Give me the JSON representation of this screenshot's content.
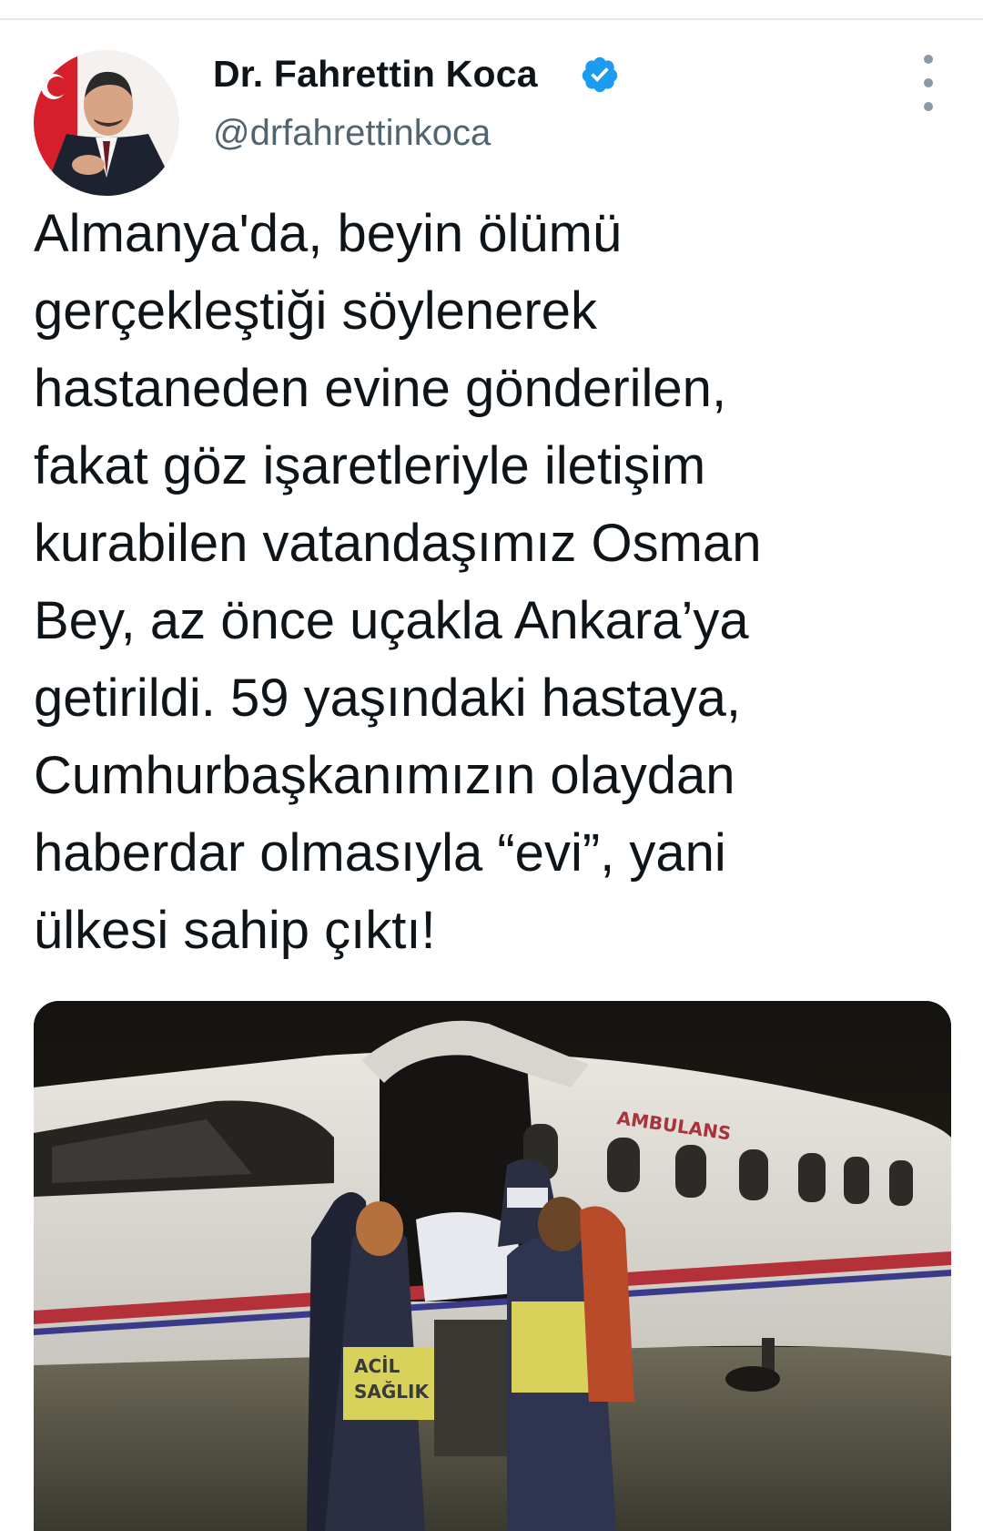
{
  "author": {
    "display_name": "Dr. Fahrettin Koca",
    "handle": "@drfahrettinkoca",
    "verified": true,
    "verified_badge_color": "#1d9bf0"
  },
  "tweet": {
    "lines": [
      "Almanya'da, beyin ölümü",
      "gerçekleştiği söylenerek",
      "hastaneden evine gönderilen,",
      "fakat göz işaretleriyle iletişim",
      "kurabilen vatandaşımız Osman",
      "Bey, az önce uçakla Ankara’ya",
      "getirildi. 59 yaşındaki hastaya,",
      "Cumhurbaşkanımızın olaydan",
      "haberdar olmasıyla “evi”, yani",
      "ülkesi sahip çıktı!"
    ]
  },
  "media": {
    "plane_text": "AMBULANS",
    "vest_text_line1": "ACİL",
    "vest_text_line2": "SAĞLIK"
  },
  "icons": {
    "verified": "verified-badge-icon",
    "more": "more-options-icon"
  },
  "colors": {
    "text": "#0f1419",
    "secondary_text": "#536471",
    "plane_stripe": "#b5313a"
  }
}
